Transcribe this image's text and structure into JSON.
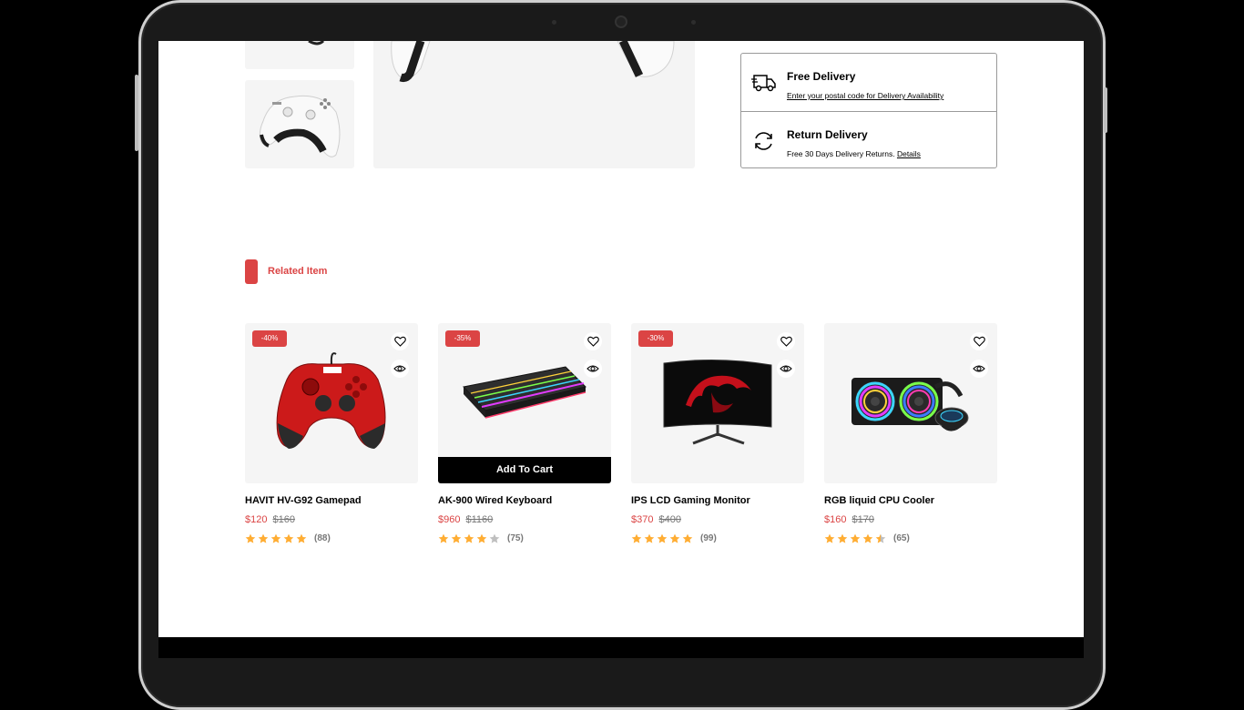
{
  "delivery": {
    "free": {
      "title": "Free Delivery",
      "sub": "Enter your postal code for Delivery Availability"
    },
    "ret": {
      "title": "Return Delivery",
      "sub": "Free 30 Days Delivery Returns.",
      "link": "Details"
    }
  },
  "related": {
    "title": "Related Item",
    "add_to_cart": "Add To Cart"
  },
  "products": [
    {
      "name": "HAVIT HV-G92 Gamepad",
      "price": "$120",
      "old_price": "$160",
      "discount": "-40%",
      "rating": 5,
      "reviews": "(88)"
    },
    {
      "name": "AK-900 Wired Keyboard",
      "price": "$960",
      "old_price": "$1160",
      "discount": "-35%",
      "rating": 4,
      "reviews": "(75)"
    },
    {
      "name": "IPS LCD Gaming Monitor",
      "price": "$370",
      "old_price": "$400",
      "discount": "-30%",
      "rating": 5,
      "reviews": "(99)"
    },
    {
      "name": "RGB liquid CPU Cooler",
      "price": "$160",
      "old_price": "$170",
      "discount": "",
      "rating": 4.5,
      "reviews": "(65)"
    }
  ],
  "colors": {
    "accent": "#db4444",
    "star": "#ffad33",
    "star_empty": "#bfbfbf"
  }
}
